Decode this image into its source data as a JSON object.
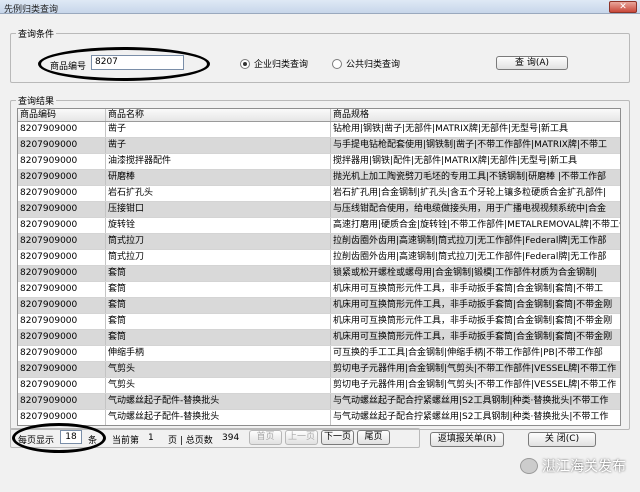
{
  "window": {
    "title": "先例归类查询",
    "close": "✕"
  },
  "query": {
    "group_label": "查询条件",
    "code_label": "商品编号",
    "code_value": "8207",
    "radio_enterprise": "企业归类查询",
    "radio_public": "公共归类查询",
    "query_button": "查 询(A)"
  },
  "results": {
    "group_label": "查询结果",
    "columns": [
      "商品编码",
      "商品名称",
      "商品规格"
    ],
    "rows": [
      [
        "8207909000",
        "凿子",
        "钻枪用|钢铁|凿子|无部件|MATRIX牌|无部件|无型号|新工具"
      ],
      [
        "8207909000",
        "凿子",
        "与手提电钻枪配套使用|钢铁制|凿子|不带工作部件|MATRIX牌|不带工"
      ],
      [
        "8207909000",
        "油漆搅拌器配件",
        "搅拌器用|钢铁|配件|无部件|MATRIX牌|无部件|无型号|新工具"
      ],
      [
        "8207909000",
        "研磨棒",
        "抛光机上加工陶瓷劈刀毛坯的专用工具|不锈钢制|研磨棒 |不带工作部"
      ],
      [
        "8207909000",
        "岩石扩孔头",
        "岩石扩孔用|合金钢制|扩孔头|含五个牙轮上镶多粒硬质合金扩孔部件|"
      ],
      [
        "8207909000",
        "压接钳口",
        "与压线钳配合使用，给电缆做接头用，用于广播电视视频系统中|合金"
      ],
      [
        "8207909000",
        "旋转铨",
        "高速打磨用|硬质合金|旋转铨|不带工作部件|METALREMOVAL牌|不带工作"
      ],
      [
        "8207909000",
        "筒式拉刀",
        "拉削齿圈外齿用|高速钢制|筒式拉刀|无工作部件|Federal牌|无工作部"
      ],
      [
        "8207909000",
        "筒式拉刀",
        "拉削齿圈外齿用|高速钢制|筒式拉刀|无工作部件|Federal牌|无工作部"
      ],
      [
        "8207909000",
        "套筒",
        "锁紧或松开螺栓或螺母用|合金钢制|锻模|工作部件材质为合金钢制|"
      ],
      [
        "8207909000",
        "套筒",
        "机床用可互换筒形元件工具，非手动扳手套筒|合金钢制|套筒|不带工"
      ],
      [
        "8207909000",
        "套筒",
        "机床用可互换筒形元件工具，非手动扳手套筒|合金钢制|套筒|不带金刚"
      ],
      [
        "8207909000",
        "套筒",
        "机床用可互换筒形元件工具，非手动扳手套筒|合金钢制|套筒|不带金刚"
      ],
      [
        "8207909000",
        "套筒",
        "机床用可互换筒形元件工具，非手动扳手套筒|合金钢制|套筒|不带金刚"
      ],
      [
        "8207909000",
        "伸缩手柄",
        "可互换的手工工具|合金钢制|伸缩手柄|不带工作部件|PB|不带工作部"
      ],
      [
        "8207909000",
        "气剪头",
        "剪切电子元器件用|合金钢制|气剪头|不带工作部件|VESSEL牌|不带工作"
      ],
      [
        "8207909000",
        "气剪头",
        "剪切电子元器件用|合金钢制|气剪头|不带工作部件|VESSEL牌|不带工作"
      ],
      [
        "8207909000",
        "气动螺丝起子配件-替换批头",
        "与气动螺丝起子配合拧紧螺丝用|S2工具钢制|种类·替换批头|不带工作"
      ],
      [
        "8207909000",
        "气动螺丝起子配件-替换批头",
        "与气动螺丝起子配合拧紧螺丝用|S2工具钢制|种类·替换批头|不带工作"
      ]
    ]
  },
  "pager": {
    "per_page_label": "每页显示",
    "per_page_value": "18",
    "per_page_unit": "条",
    "current_label": "当前第",
    "current_value": "1",
    "page_unit_total": "页 | 总页数",
    "total_pages": "394",
    "first": "首页",
    "prev": "上一页",
    "next": "下一页",
    "last": "尾页"
  },
  "actions": {
    "report": "返填报关单(R)",
    "close": "关 闭(C)"
  },
  "watermark": {
    "text": "湛江海关发布"
  }
}
